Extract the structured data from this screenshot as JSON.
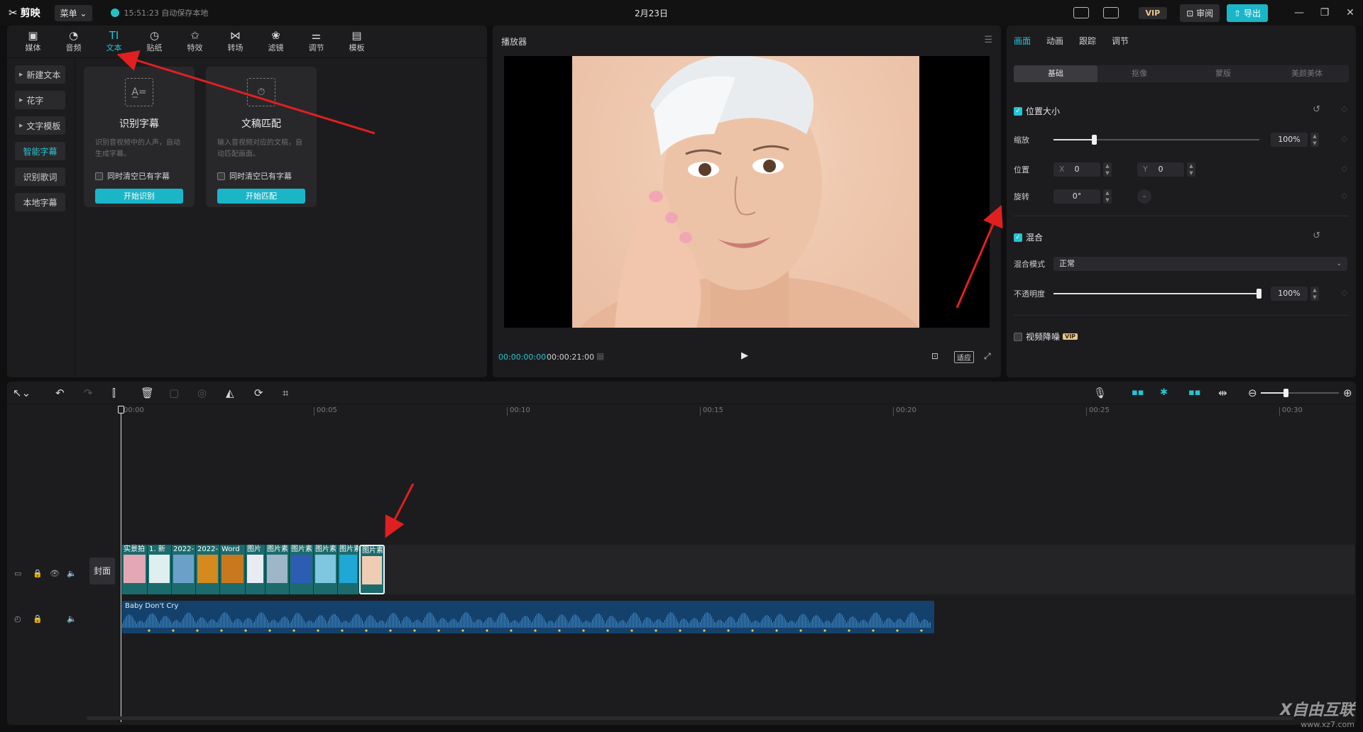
{
  "app": {
    "logo": "剪映",
    "menu_label": "菜单",
    "autosave": "15:51:23 自动保存本地",
    "project_title": "2月23日",
    "vip": "VIP",
    "review": "审阅",
    "export": "导出",
    "minimize": "—",
    "restore": "❐",
    "close": "✕"
  },
  "categories": [
    {
      "label": "媒体",
      "icon": "▣"
    },
    {
      "label": "音频",
      "icon": "◔"
    },
    {
      "label": "文本",
      "icon": "TI"
    },
    {
      "label": "贴纸",
      "icon": "◷"
    },
    {
      "label": "特效",
      "icon": "✩"
    },
    {
      "label": "转场",
      "icon": "⋈"
    },
    {
      "label": "滤镜",
      "icon": "❀"
    },
    {
      "label": "调节",
      "icon": "⚌"
    },
    {
      "label": "模板",
      "icon": "▤"
    }
  ],
  "text_menu": [
    {
      "label": "新建文本"
    },
    {
      "label": "花字"
    },
    {
      "label": "文字模板"
    },
    {
      "label": "智能字幕"
    },
    {
      "label": "识别歌词"
    },
    {
      "label": "本地字幕"
    }
  ],
  "cards": [
    {
      "title": "识别字幕",
      "desc": "识别音视频中的人声，自动生成字幕。",
      "checkbox": "同时清空已有字幕",
      "button": "开始识别",
      "icon": "A̲="
    },
    {
      "title": "文稿匹配",
      "desc": "输入音视频对应的文稿，自动匹配画面。",
      "checkbox": "同时清空已有字幕",
      "button": "开始匹配",
      "icon": "⏱"
    }
  ],
  "player": {
    "title": "播放器",
    "current_time": "00:00:00:00",
    "total_time": "00:00:21:00",
    "ratio_label": "适应"
  },
  "inspector": {
    "tabs": [
      "画面",
      "动画",
      "跟踪",
      "调节"
    ],
    "subtabs": [
      "基础",
      "抠像",
      "蒙版",
      "美颜美体"
    ],
    "position_size": {
      "title": "位置大小",
      "scale_label": "缩放",
      "scale_value": "100%",
      "scale_fraction": 0.2,
      "position_label": "位置",
      "x_axis": "X",
      "x_value": "0",
      "y_axis": "Y",
      "y_value": "0",
      "rotate_label": "旋转",
      "rotate_value": "0°"
    },
    "blend": {
      "title": "混合",
      "mode_label": "混合模式",
      "mode_value": "正常",
      "opacity_label": "不透明度",
      "opacity_value": "100%",
      "opacity_fraction": 1.0
    },
    "denoise": {
      "title": "视频降噪",
      "badge": "VIP"
    }
  },
  "timeline": {
    "cover_label": "封面",
    "ruler": [
      "00:00",
      "00:05",
      "00:10",
      "00:15",
      "00:20",
      "00:25",
      "00:30"
    ],
    "video_clips": [
      {
        "label": "实景拍",
        "color": "#e3a7b5"
      },
      {
        "label": "1. 新",
        "color": "#dfeeee"
      },
      {
        "label": "2022-",
        "color": "#6ba1c9"
      },
      {
        "label": "2022-",
        "color": "#d48a1f"
      },
      {
        "label": "Word",
        "color": "#c9781e"
      },
      {
        "label": "图片",
        "color": "#e8ecf2"
      },
      {
        "label": "图片素",
        "color": "#9fb6c8"
      },
      {
        "label": "图片素",
        "color": "#2d5db3"
      },
      {
        "label": "图片素",
        "color": "#7fc6e0"
      },
      {
        "label": "图片素",
        "color": "#1fa7d6"
      },
      {
        "label": "图片素",
        "color": "#efcdb5"
      }
    ],
    "audio_title": "Baby Don't Cry"
  },
  "watermark": {
    "brand": "X自由互联",
    "url": "www.xz7.com"
  }
}
